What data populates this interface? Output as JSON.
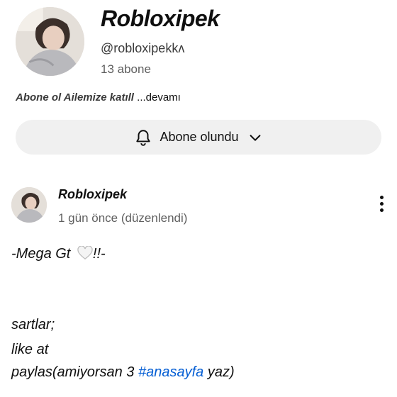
{
  "channel": {
    "name": "Robloxipek",
    "handle": "@robloxipekkᴧ",
    "subscribers": "13 abone",
    "description_italic": "Abone ol Ailemize katıll",
    "description_more": " ...devamı"
  },
  "subscribe_button": {
    "label": "Abone olundu",
    "icon": "bell-icon",
    "dropdown_icon": "chevron-down-icon"
  },
  "post": {
    "author": "Robloxipek",
    "time": "1 gün önce (düzenlendi)",
    "menu_icon": "more-vertical-icon",
    "line1_before": "-Mega Gt ",
    "line1_after": "!!-",
    "line2": "sartlar;",
    "line3": "like at",
    "line4_before": "paylas(amiyorsan 3 ",
    "hashtag": "#anasayfa",
    "line4_after": " yaz)"
  }
}
